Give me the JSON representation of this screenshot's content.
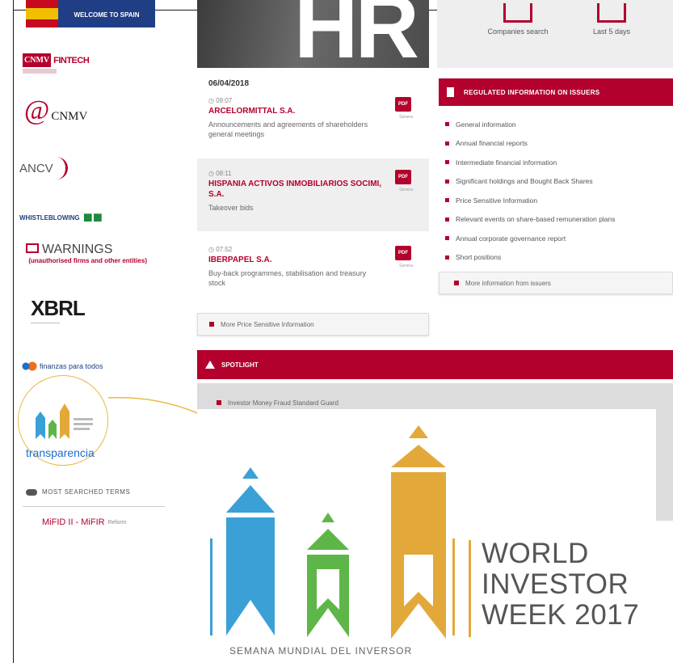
{
  "sidebar": {
    "welcome": "WELCOME TO SPAIN",
    "cnmv_fintech": {
      "cnmv": "CNMV",
      "fintech": "FINTECH"
    },
    "at_cnmv": {
      "at": "@",
      "label": "CNMV"
    },
    "ancv": "ANCV",
    "whistleblowing": "WHISTLEBLOWING",
    "warnings": {
      "title": "WARNINGS",
      "sub": "(unauthorised firms and other entities)"
    },
    "xbrl": {
      "title": "XBRL"
    },
    "finanzas": "finanzas para todos",
    "transparencia": "transparencia",
    "most_searched": "MOST SEARCHED TERMS",
    "mifid": {
      "term": "MiFID II - MiFIR",
      "sub": "Reform"
    }
  },
  "hero": {
    "text": "HR"
  },
  "tools": [
    {
      "label": "Companies search"
    },
    {
      "label": "Last 5 days"
    }
  ],
  "news": {
    "date": "06/04/2018",
    "items": [
      {
        "time": "09:07",
        "company": "ARCELORMITTAL S.A.",
        "desc": "Announcements and agreements of shareholders general meetings",
        "pdf": "PDF",
        "pdf_label": "Genera"
      },
      {
        "time": "08:11",
        "company": "HISPANIA ACTIVOS INMOBILIARIOS SOCIMI, S.A.",
        "desc": "Takeover bids",
        "pdf": "PDF",
        "pdf_label": "Genera"
      },
      {
        "time": "07:52",
        "company": "IBERPAPEL S.A.",
        "desc": "Buy-back programmes, stabilisation and treasury stock",
        "pdf": "PDF",
        "pdf_label": "Genera"
      }
    ],
    "more": "More Price Sensitive Information"
  },
  "regulated": {
    "title": "REGULATED INFORMATION ON ISSUERS",
    "items": [
      "General information",
      "Annual financial reports",
      "Intermediate financial information",
      "Significant holdings and Bought Back Shares",
      "Price Sensitive Information",
      "Relevant events on share-based remuneration plans",
      "Annual corporate governance report",
      "Short positions"
    ],
    "more": "More information from issuers"
  },
  "spotlight": {
    "title": "SPOTLIGHT",
    "first_item": "Investor Money Fraud Standard Guard"
  },
  "overlay": {
    "title_lines": [
      "WORLD",
      "INVESTOR",
      "WEEK 2017"
    ],
    "subtitle": "SEMANA MUNDIAL DEL INVERSOR"
  },
  "colors": {
    "brand": "#b3002d",
    "blue": "#3aa0d6",
    "green": "#5db647",
    "gold": "#e2a93a"
  }
}
